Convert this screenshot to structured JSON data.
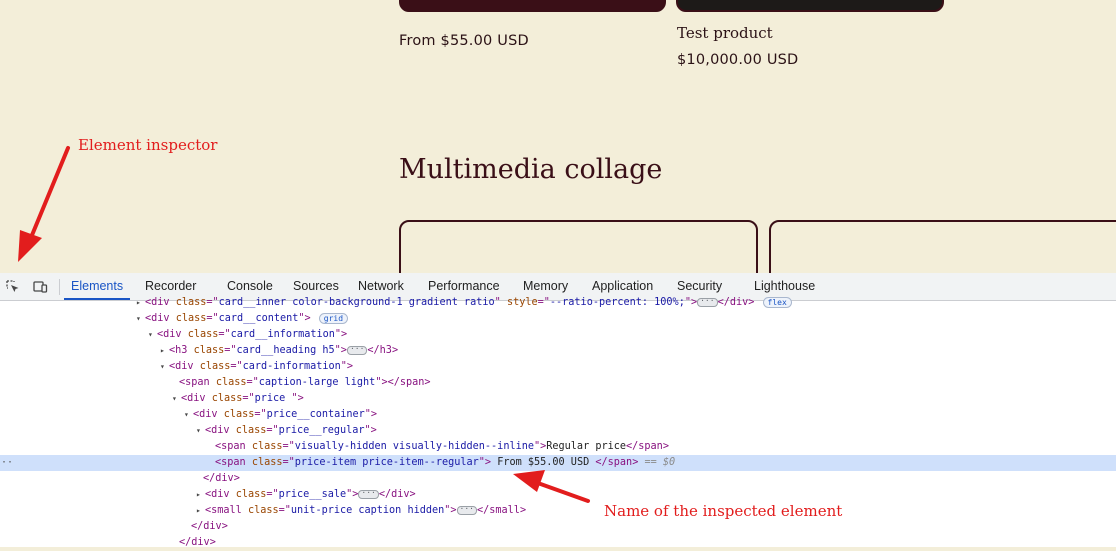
{
  "storefront": {
    "product_1_price": "From $55.00 USD",
    "product_2_title": "Test product",
    "product_2_price": "$10,000.00 USD",
    "section_title": "Multimedia collage"
  },
  "annotations": {
    "inspector_label": "Element inspector",
    "element_name_label": "Name of the inspected element",
    "color": "#e21d1d"
  },
  "devtools": {
    "tabs": [
      "Elements",
      "Recorder",
      "Console",
      "Sources",
      "Network",
      "Performance",
      "Memory",
      "Application",
      "Security",
      "Lighthouse"
    ],
    "active_tab": "Elements",
    "accent": "#1a55c5"
  },
  "dom": {
    "l0": {
      "tag": "div",
      "attr": "class",
      "value": "card__inner color-background-1 gradient ratio",
      "attr2": "style",
      "value2": "--ratio-percent: 100%;",
      "badge": "flex"
    },
    "l1": {
      "tag": "div",
      "attr": "class",
      "value": "card__content",
      "badge": "grid"
    },
    "l2": {
      "tag": "div",
      "attr": "class",
      "value": "card__information"
    },
    "l3": {
      "tag": "h3",
      "attr": "class",
      "value": "card__heading h5"
    },
    "l4": {
      "tag": "div",
      "attr": "class",
      "value": "card-information"
    },
    "l5": {
      "tag": "span",
      "attr": "class",
      "value": "caption-large light"
    },
    "l6": {
      "tag": "div",
      "attr": "class",
      "value": "price "
    },
    "l7": {
      "tag": "div",
      "attr": "class",
      "value": "price__container"
    },
    "l8": {
      "tag": "div",
      "attr": "class",
      "value": "price__regular"
    },
    "l9": {
      "tag": "span",
      "attr": "class",
      "value": "visually-hidden visually-hidden--inline",
      "text": "Regular price"
    },
    "l10": {
      "tag": "span",
      "attr": "class",
      "value": "price-item price-item--regular",
      "text": " From $55.00 USD ",
      "selected": "== $0"
    },
    "l11": {
      "tag": "div"
    },
    "l12": {
      "tag": "div",
      "attr": "class",
      "value": "price__sale"
    },
    "l13": {
      "tag": "small",
      "attr": "class",
      "value": "unit-price caption hidden"
    },
    "l14": {
      "tag": "div"
    },
    "l15": {
      "tag": "div"
    }
  }
}
